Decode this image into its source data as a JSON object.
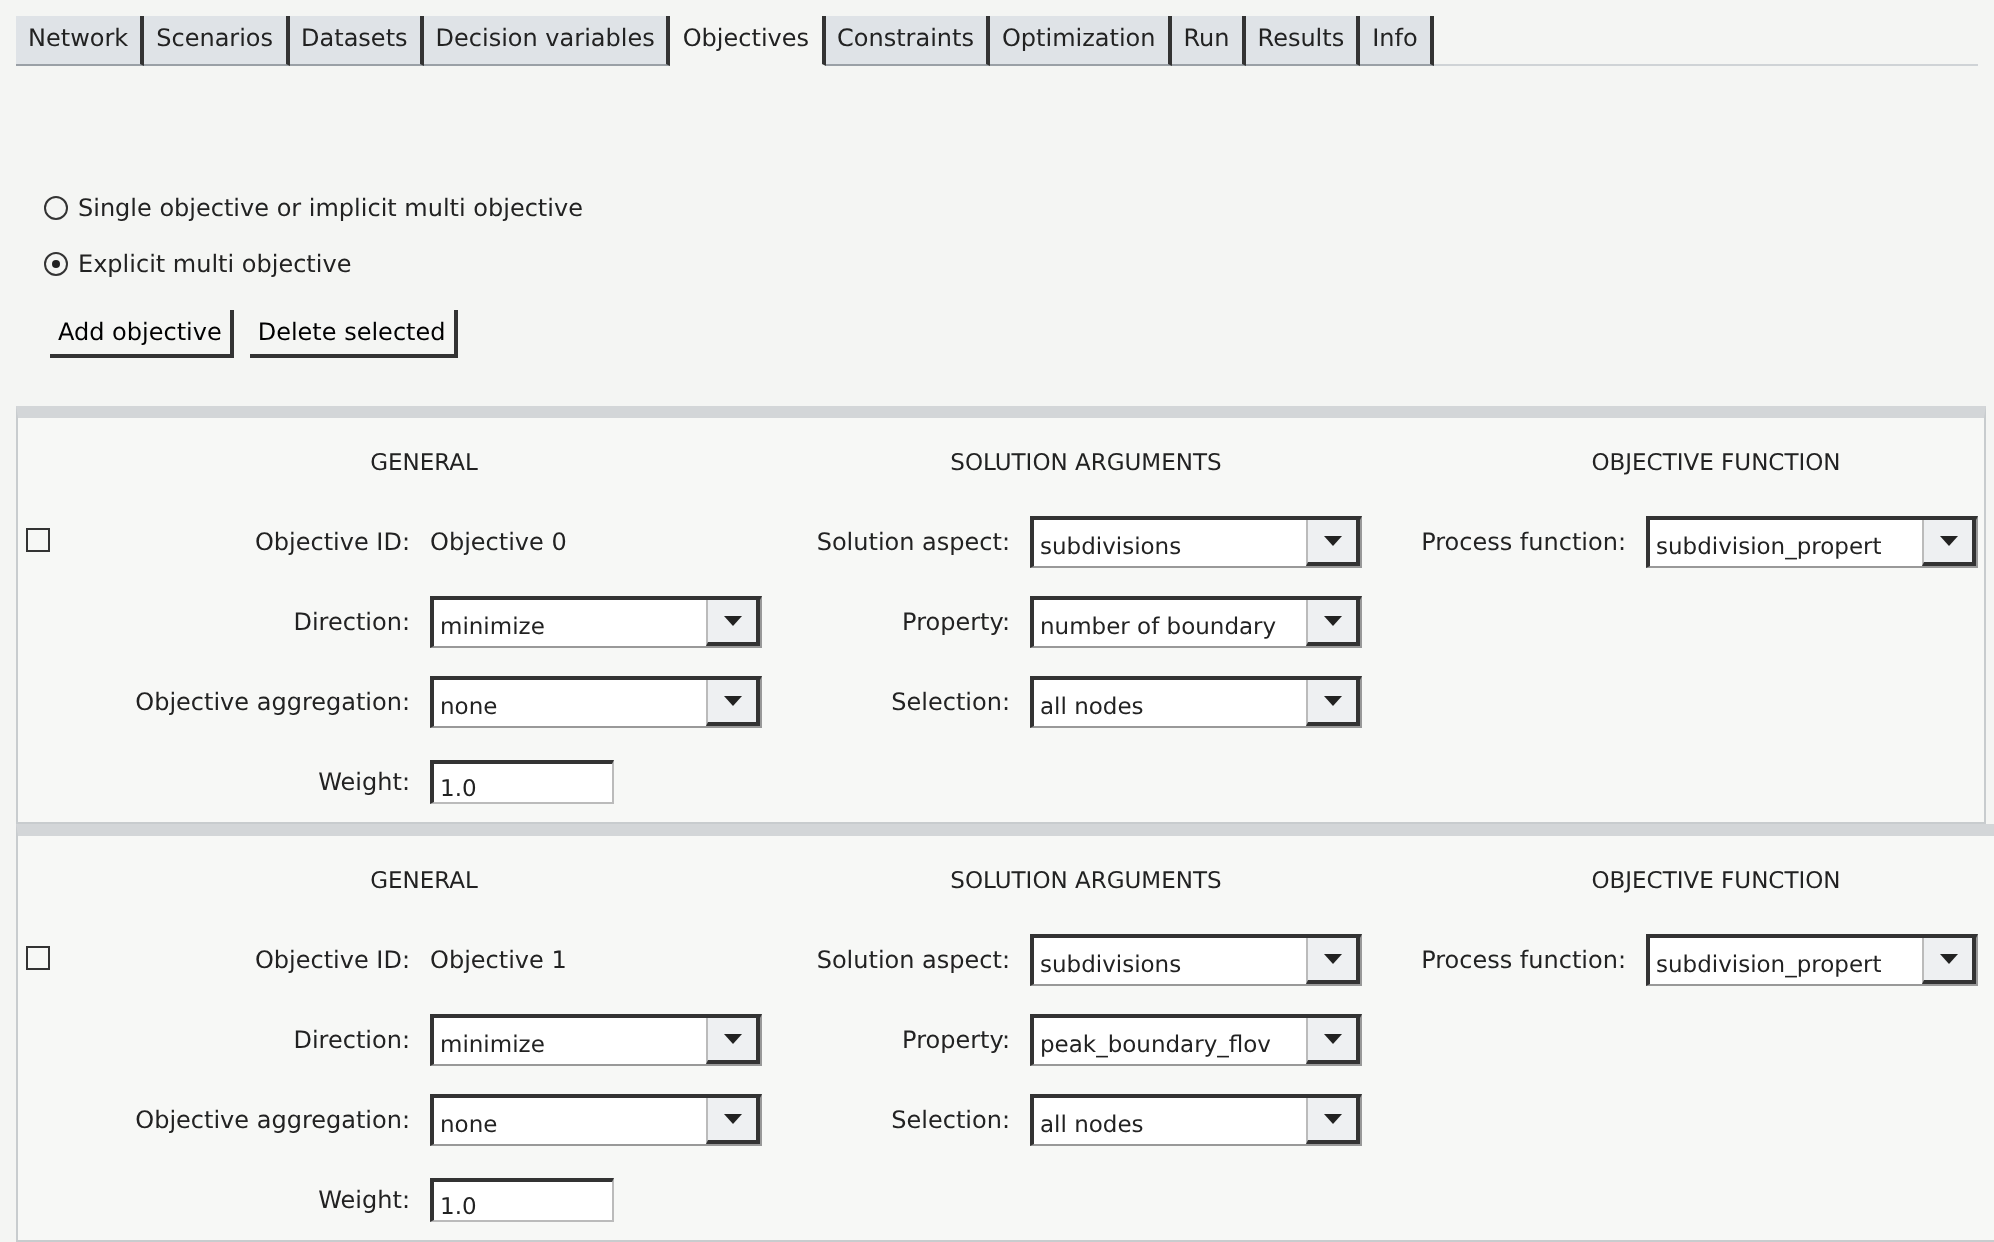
{
  "tabs": [
    {
      "label": "Network",
      "selected": false
    },
    {
      "label": "Scenarios",
      "selected": false
    },
    {
      "label": "Datasets",
      "selected": false
    },
    {
      "label": "Decision variables",
      "selected": false
    },
    {
      "label": "Objectives",
      "selected": true
    },
    {
      "label": "Constraints",
      "selected": false
    },
    {
      "label": "Optimization",
      "selected": false
    },
    {
      "label": "Run",
      "selected": false
    },
    {
      "label": "Results",
      "selected": false
    },
    {
      "label": "Info",
      "selected": false
    }
  ],
  "mode_options": [
    {
      "label": "Single objective or implicit multi objective",
      "selected": false
    },
    {
      "label": "Explicit multi objective",
      "selected": true
    }
  ],
  "buttons": [
    "Add objective",
    "Delete selected"
  ],
  "objectives": [
    {
      "checked": false,
      "headings": [
        "GENERAL",
        "SOLUTION ARGUMENTS",
        "OBJECTIVE FUNCTION"
      ],
      "id_label": "Objective ID:",
      "id": "Objective 0",
      "direction_label": "Direction:",
      "direction": "minimize",
      "aggregation_label": "Objective aggregation:",
      "aggregation": "none",
      "weight_label": "Weight:",
      "weight": "1.0",
      "aspect_label": "Solution aspect:",
      "aspect": "subdivisions",
      "property_label": "Property:",
      "property": "number of boundary",
      "selection_label": "Selection:",
      "selection": "all nodes",
      "process_label": "Process function:",
      "process": "subdivision_propert"
    },
    {
      "checked": false,
      "headings": [
        "GENERAL",
        "SOLUTION ARGUMENTS",
        "OBJECTIVE FUNCTION"
      ],
      "id_label": "Objective ID:",
      "id": "Objective 1",
      "direction_label": "Direction:",
      "direction": "minimize",
      "aggregation_label": "Objective aggregation:",
      "aggregation": "none",
      "weight_label": "Weight:",
      "weight": "1.0",
      "aspect_label": "Solution aspect:",
      "aspect": "subdivisions",
      "property_label": "Property:",
      "property": "peak_boundary_flov",
      "selection_label": "Selection:",
      "selection": "all nodes",
      "process_label": "Process function:",
      "process": "subdivision_propert"
    }
  ]
}
